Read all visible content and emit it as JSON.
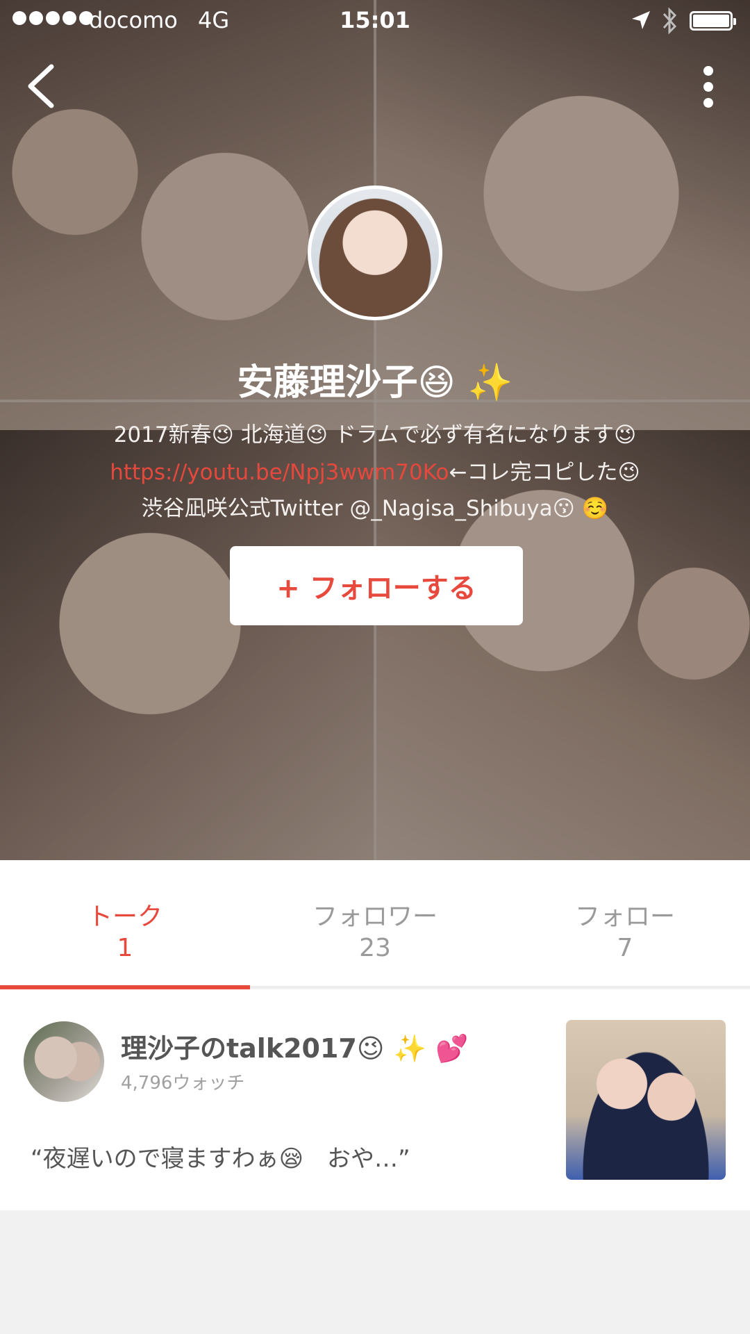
{
  "status_bar": {
    "carrier": "docomo",
    "network": "4G",
    "time": "15:01"
  },
  "profile": {
    "name": "安藤理沙子😆 ✨",
    "bio_line1": "2017新春😉 北海道😉 ドラムで必ず有名になります😉",
    "bio_link": "https://youtu.be/Npj3wwm70Ko",
    "bio_line2_suffix": "←コレ完コピした😉",
    "bio_line3": "渋谷凪咲公式Twitter @_Nagisa_Shibuya😗 ☺️",
    "follow_label": "+ フォローする"
  },
  "tabs": [
    {
      "label": "トーク",
      "count": "1",
      "active": true
    },
    {
      "label": "フォロワー",
      "count": "23",
      "active": false
    },
    {
      "label": "フォロー",
      "count": "7",
      "active": false
    }
  ],
  "talks": [
    {
      "title": "理沙子のtalk2017😉 ✨ 💕",
      "watch_count": "4,796ウォッチ",
      "excerpt": "“夜遅いので寝ますわぁ😪　おや…”"
    }
  ],
  "colors": {
    "accent": "#e7493d",
    "background": "#f1f1f1"
  }
}
